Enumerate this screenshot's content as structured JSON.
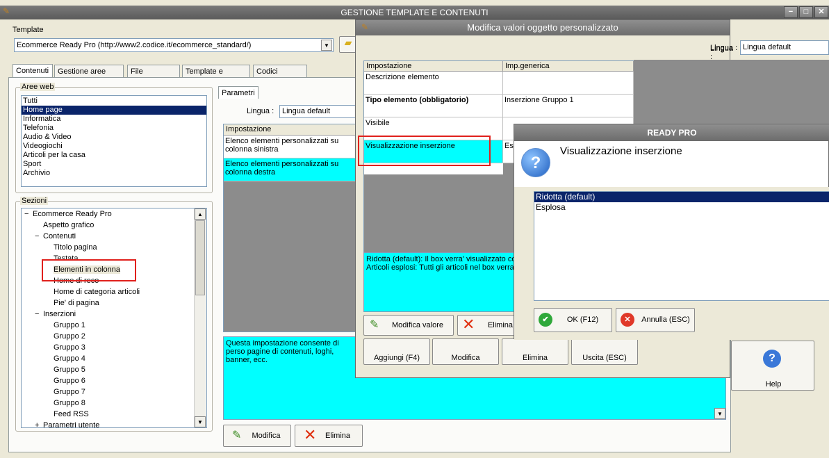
{
  "main_window": {
    "title": "GESTIONE TEMPLATE E CONTENUTI",
    "template_label": "Template",
    "template_value": "Ecommerce Ready Pro (http://www2.codice.it/ecommerce_standard/)",
    "tabs": [
      "Contenuti",
      "Gestione aree web",
      "File aggiuntivi",
      "Template e plugins",
      "Codici Coupon"
    ],
    "aree_web": {
      "label": "Aree web",
      "items": [
        "Tutti",
        "Home page",
        "Informatica",
        "Telefonia",
        "Audio & Video",
        "Videogiochi",
        "Articoli per la casa",
        "Sport",
        "Archivio"
      ],
      "selected": "Home page"
    },
    "sezioni": {
      "label": "Sezioni",
      "tree": [
        {
          "text": "Ecommerce Ready Pro",
          "level": 0,
          "expander": "−"
        },
        {
          "text": "Aspetto grafico",
          "level": 1,
          "expander": ""
        },
        {
          "text": "Contenuti",
          "level": 1,
          "expander": "−"
        },
        {
          "text": "Titolo pagina",
          "level": 2,
          "expander": ""
        },
        {
          "text": "Testata",
          "level": 2,
          "expander": ""
        },
        {
          "text": "Elementi in colonna",
          "level": 2,
          "expander": ""
        },
        {
          "text": "Home di reco",
          "level": 2,
          "expander": ""
        },
        {
          "text": "Home di categoria articoli",
          "level": 2,
          "expander": ""
        },
        {
          "text": "Pie' di pagina",
          "level": 2,
          "expander": ""
        },
        {
          "text": "Inserzioni",
          "level": 1,
          "expander": "−"
        },
        {
          "text": "Gruppo 1",
          "level": 2,
          "expander": ""
        },
        {
          "text": "Gruppo 2",
          "level": 2,
          "expander": ""
        },
        {
          "text": "Gruppo 3",
          "level": 2,
          "expander": ""
        },
        {
          "text": "Gruppo 4",
          "level": 2,
          "expander": ""
        },
        {
          "text": "Gruppo 5",
          "level": 2,
          "expander": ""
        },
        {
          "text": "Gruppo 6",
          "level": 2,
          "expander": ""
        },
        {
          "text": "Gruppo 7",
          "level": 2,
          "expander": ""
        },
        {
          "text": "Gruppo 8",
          "level": 2,
          "expander": ""
        },
        {
          "text": "Feed RSS",
          "level": 2,
          "expander": ""
        },
        {
          "text": "Parametri utente",
          "level": 1,
          "expander": "+"
        }
      ]
    },
    "parametri": {
      "tab": "Parametri",
      "lingua_label": "Lingua :",
      "lingua_value": "Lingua default",
      "col_impostazione": "Impostazione",
      "rows": [
        "Elenco elementi personalizzati su colonna sinistra",
        "Elenco elementi personalizzati su colonna destra"
      ],
      "description": "Questa impostazione consente di perso pagine di contenuti, loghi, banner, ecc."
    },
    "buttons": {
      "modifica": "Modifica",
      "elimina": "Elimina",
      "aggiungi": "Aggiungi (F4)",
      "modifica2": "Modifica",
      "elimina2": "Elimina",
      "uscita": "Uscita (ESC)",
      "help": "Help"
    }
  },
  "edit_window": {
    "title": "Modifica valori oggetto personalizzato",
    "lingua_label": "Lingua :",
    "lingua_value": "Lingua default",
    "col_impostazione": "Impostazione",
    "col_generica": "Imp.generica",
    "rows": [
      {
        "name": "Descrizione elemento",
        "value": "",
        "bold": false
      },
      {
        "name": "Tipo elemento (obbligatorio)",
        "value": "Inserzione Gruppo 1",
        "bold": true
      },
      {
        "name": "Visibile",
        "value": "",
        "bold": false
      },
      {
        "name": "Visualizzazione inserzione",
        "value": "Esp",
        "bold": false
      }
    ],
    "info_line1": "Ridotta (default): Il box verra' visualizzato co",
    "info_line2": "Articoli esplosi: Tutti gli articoli nel box verran",
    "btn_modifica_valore": "Modifica valore",
    "btn_elimina": "Elimina"
  },
  "dialog": {
    "title": "READY PRO",
    "heading": "Visualizzazione inserzione",
    "options": [
      "Ridotta (default)",
      "Esplosa"
    ],
    "selected": "Ridotta (default)",
    "ok": "OK (F12)",
    "annulla": "Annulla (ESC)"
  },
  "colors": {
    "highlight_cyan": "#00ffff",
    "selection": "#0a246a",
    "annotation_red": "#e0201c"
  }
}
